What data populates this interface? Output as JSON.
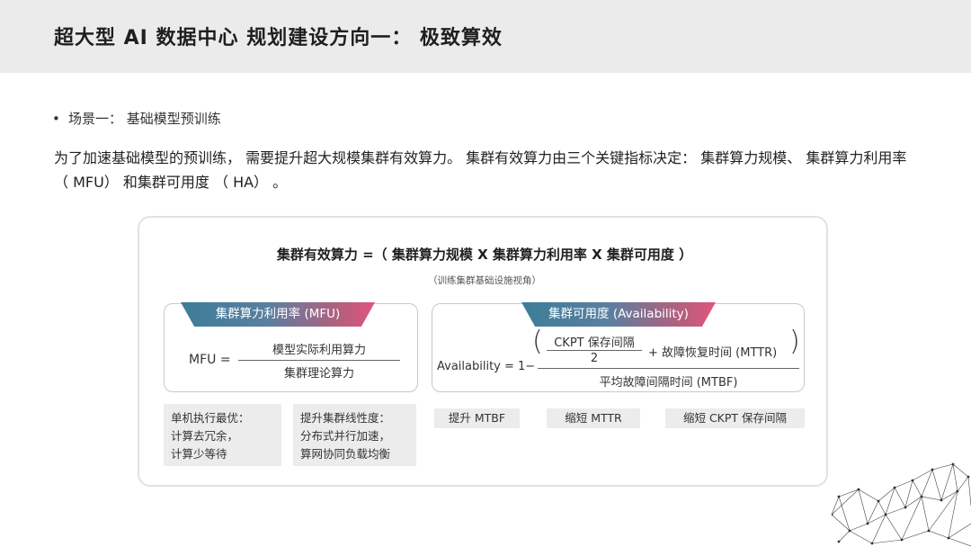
{
  "header": {
    "title": "超大型 AI 数据中心 规划建设方向一： 极致算效"
  },
  "bullet": {
    "dot": "•",
    "text": "场景一： 基础模型预训练"
  },
  "paragraph": "为了加速基础模型的预训练， 需要提升超大规模集群有效算力。 集群有效算力由三个关键指标决定： 集群算力规模、 集群算力利用率 （ MFU） 和集群可用度 （ HA） 。",
  "figure": {
    "formula_title": "集群有效算力 =（ 集群算力规模 X 集群算力利用率 X 集群可用度 ）",
    "formula_subtitle": "（训练集群基础设施视角）",
    "mfu": {
      "tab": "集群算力利用率 (MFU)",
      "lhs": "MFU =",
      "numerator": "模型实际利用算力",
      "denominator": "集群理论算力"
    },
    "availability": {
      "tab": "集群可用度 (Availability)",
      "lhs": "Availability = 1−",
      "paren_left": "(",
      "paren_right": ")",
      "inner_numerator": "CKPT 保存间隔",
      "inner_denominator": "2",
      "plus_term": "+ 故障恢复时间 (MTTR)",
      "denominator": "平均故障间隔时间 (MTBF)"
    },
    "chips": {
      "mfu_1": [
        "单机执行最优：",
        "计算去冗余，",
        "计算少等待"
      ],
      "mfu_2": [
        "提升集群线性度：",
        "分布式并行加速，",
        "算网协同负载均衡"
      ],
      "avail_1": "提升 MTBF",
      "avail_2": "缩短 MTTR",
      "avail_3": "缩短 CKPT 保存间隔"
    }
  },
  "colors": {
    "header_bg": "#ebebeb",
    "tab_gradient_start": "#3b7d98",
    "tab_gradient_end": "#e0557a",
    "chip_bg": "#ececec"
  },
  "decoration": {
    "network": "network-graph-icon"
  }
}
